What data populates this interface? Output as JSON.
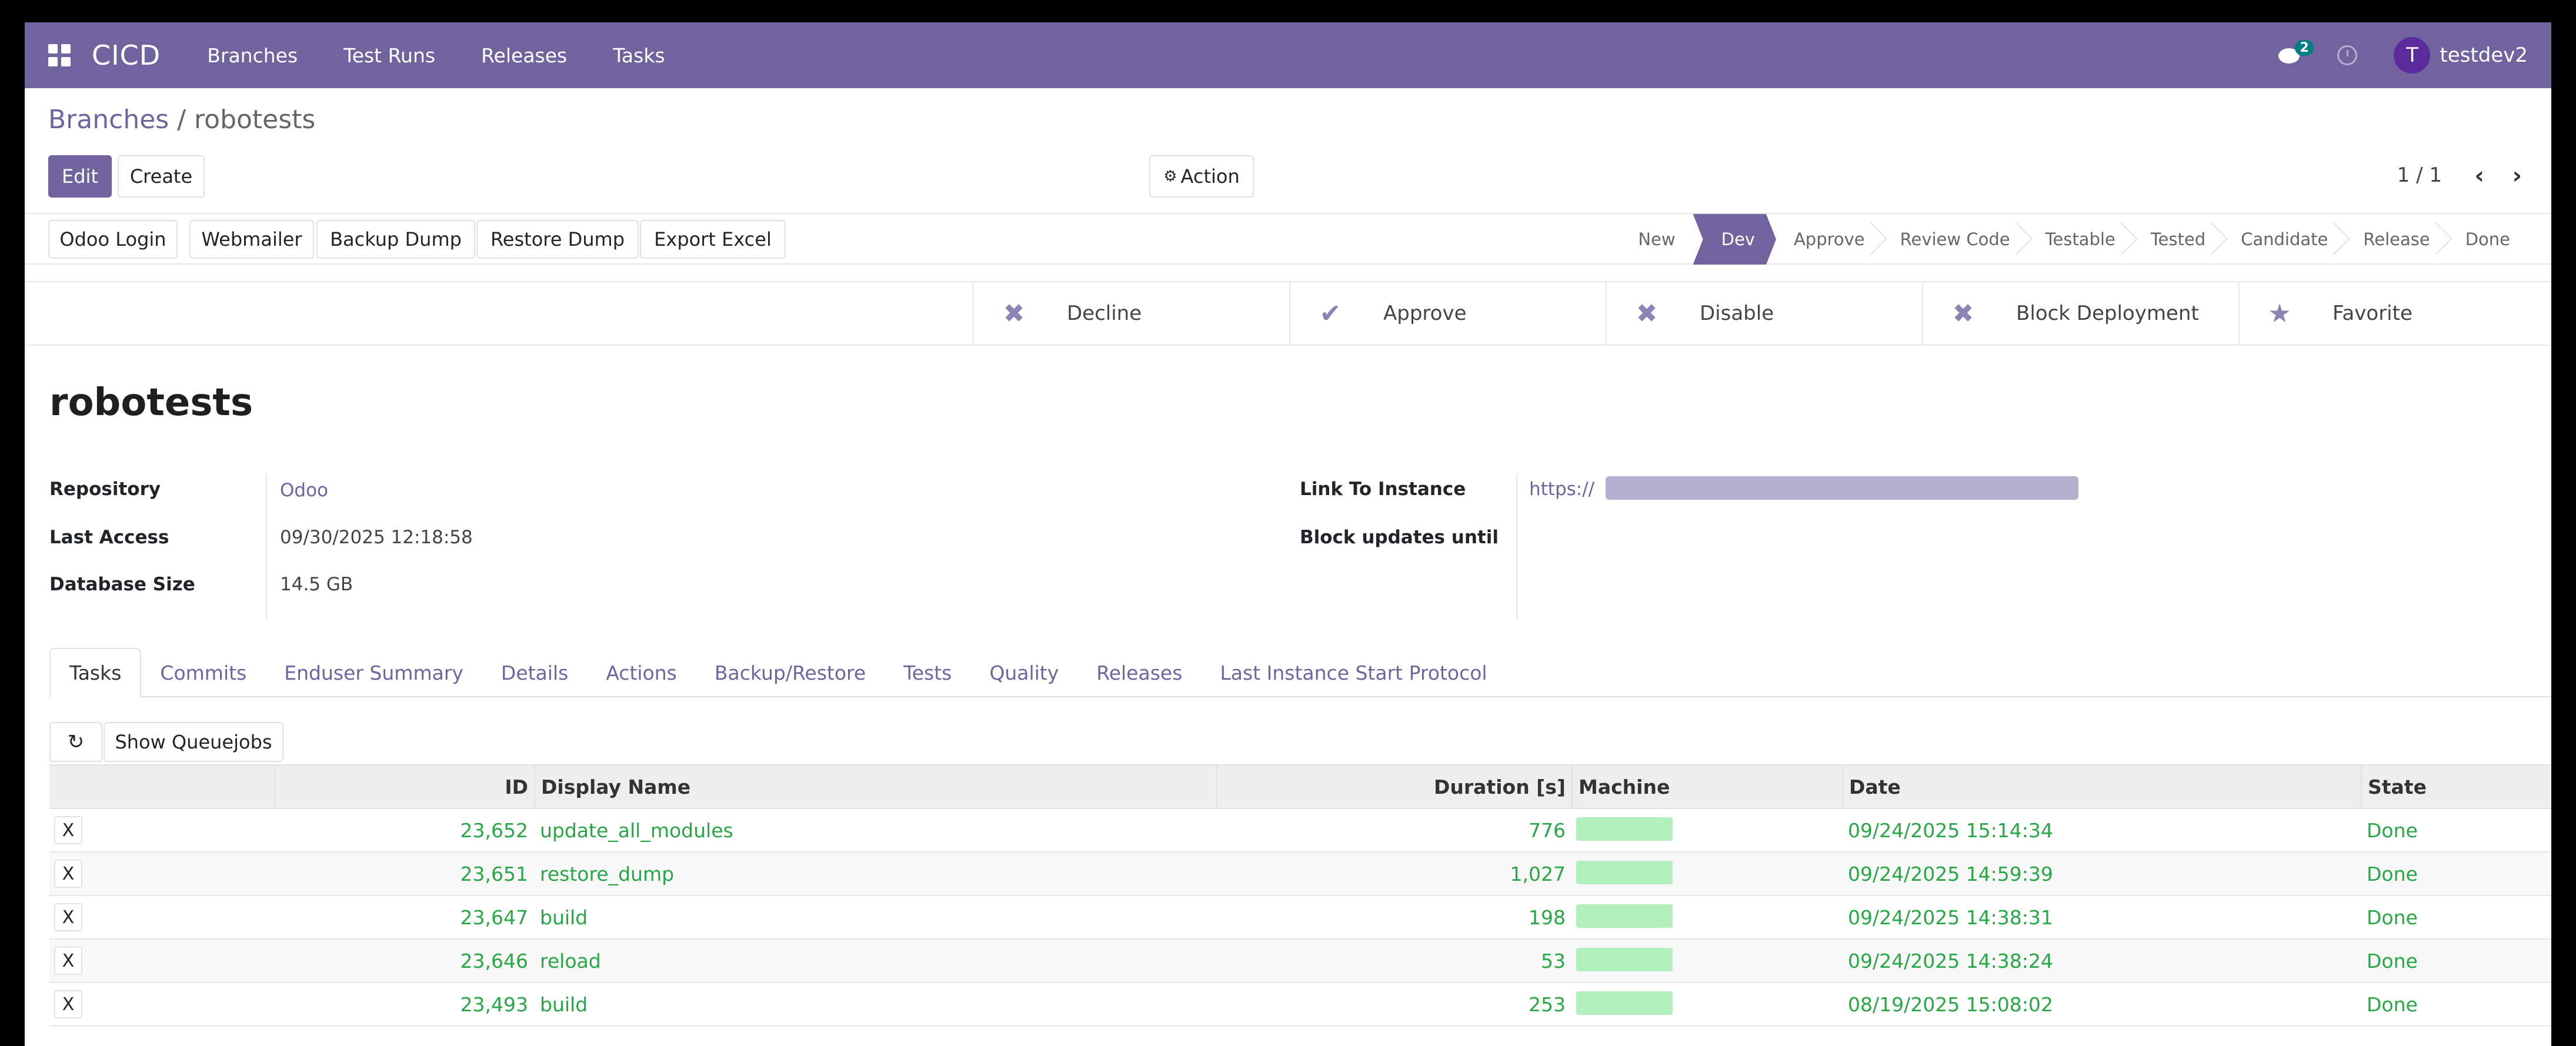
{
  "navbar": {
    "brand": "CICD",
    "items": [
      "Branches",
      "Test Runs",
      "Releases",
      "Tasks"
    ],
    "chat_badge": "2",
    "user_initial": "T",
    "username": "testdev2"
  },
  "breadcrumb": {
    "parent": "Branches",
    "separator": "/",
    "current": "robotests"
  },
  "toolbar": {
    "edit": "Edit",
    "create": "Create",
    "action": "Action"
  },
  "pager": {
    "text": "1 / 1"
  },
  "statusbar": {
    "buttons": [
      "Odoo Login",
      "Webmailer",
      "Backup Dump",
      "Restore Dump",
      "Export Excel"
    ],
    "stages": [
      "New",
      "Dev",
      "Approve",
      "Review Code",
      "Testable",
      "Tested",
      "Candidate",
      "Release",
      "Done"
    ],
    "active_stage": "Dev"
  },
  "button_box": [
    {
      "label": "Decline",
      "icon": "x-icon"
    },
    {
      "label": "Approve",
      "icon": "check-icon"
    },
    {
      "label": "Disable",
      "icon": "x-icon"
    },
    {
      "label": "Block Deployment",
      "icon": "x-icon"
    },
    {
      "label": "Favorite",
      "icon": "star-icon"
    }
  ],
  "record": {
    "title": "robotests",
    "fields_left": [
      {
        "label": "Repository",
        "value": "Odoo"
      },
      {
        "label": "Last Access",
        "value": "09/30/2025 12:18:58"
      },
      {
        "label": "Database Size",
        "value": "14.5 GB"
      }
    ],
    "fields_right": [
      {
        "label": "Link To Instance",
        "value": "https://"
      },
      {
        "label": "Block updates until",
        "value": ""
      }
    ]
  },
  "tabs": [
    "Tasks",
    "Commits",
    "Enduser Summary",
    "Details",
    "Actions",
    "Backup/Restore",
    "Tests",
    "Quality",
    "Releases",
    "Last Instance Start Protocol"
  ],
  "tasks": {
    "show_queuejobs": "Show Queuejobs",
    "columns": [
      "ID",
      "Display Name",
      "Duration [s]",
      "Machine",
      "Date",
      "State"
    ],
    "rows": [
      {
        "x": "X",
        "id": "23,652",
        "name": "update_all_modules",
        "duration": "776",
        "date": "09/24/2025 15:14:34",
        "state": "Done"
      },
      {
        "x": "X",
        "id": "23,651",
        "name": "restore_dump",
        "duration": "1,027",
        "date": "09/24/2025 14:59:39",
        "state": "Done"
      },
      {
        "x": "X",
        "id": "23,647",
        "name": "build",
        "duration": "198",
        "date": "09/24/2025 14:38:31",
        "state": "Done"
      },
      {
        "x": "X",
        "id": "23,646",
        "name": "reload",
        "duration": "53",
        "date": "09/24/2025 14:38:24",
        "state": "Done"
      },
      {
        "x": "X",
        "id": "23,493",
        "name": "build",
        "duration": "253",
        "date": "08/19/2025 15:08:02",
        "state": "Done"
      }
    ]
  },
  "colors": {
    "brand": "#71639e",
    "done_text": "#28a745",
    "machine_bar": "#b1f0bd"
  }
}
